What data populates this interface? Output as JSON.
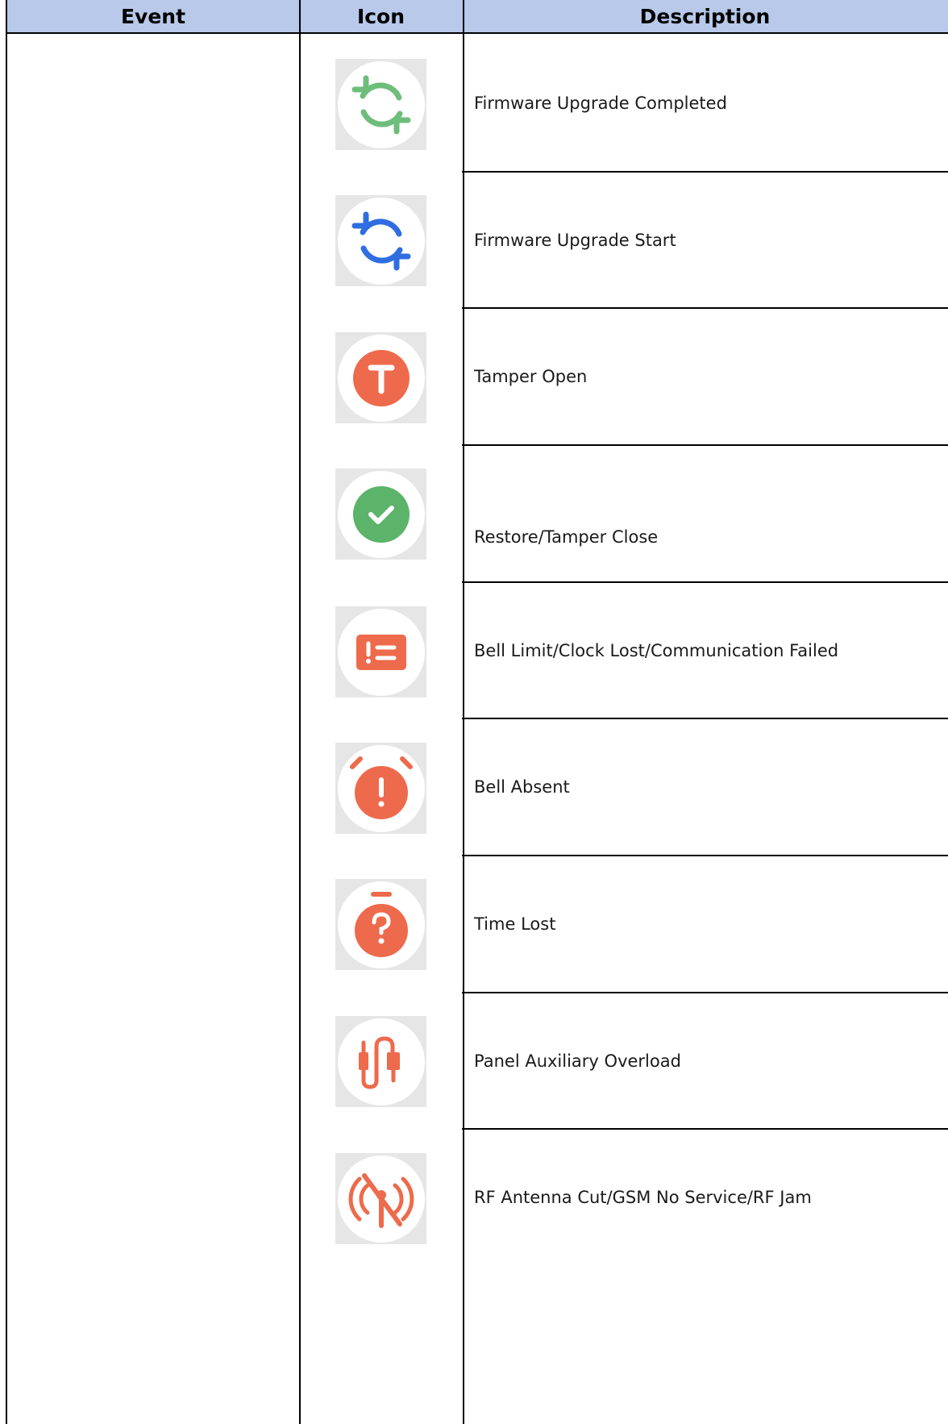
{
  "table": {
    "headers": {
      "event": "Event",
      "icon": "Icon",
      "description": "Description"
    },
    "rows": [
      {
        "icon": "sync-icon",
        "color": "#6dbd7b",
        "description": "Firmware Upgrade Completed"
      },
      {
        "icon": "sync-icon",
        "color": "#2f6de1",
        "description": "Firmware Upgrade Start"
      },
      {
        "icon": "tamper-t-icon",
        "color": "#ee6a4c",
        "description": "Tamper Open"
      },
      {
        "icon": "check-icon",
        "color": "#5cb36a",
        "description": "Restore/Tamper Close"
      },
      {
        "icon": "alert-list-icon",
        "color": "#ee6a4c",
        "description": "Bell Limit/Clock Lost/Communication Failed"
      },
      {
        "icon": "alarm-clock-exclamation-icon",
        "color": "#ee6a4c",
        "description": "Bell Absent"
      },
      {
        "icon": "stopwatch-question-icon",
        "color": "#ee6a4c",
        "description": "Time Lost"
      },
      {
        "icon": "cable-plug-icon",
        "color": "#ee6a4c",
        "description": "Panel Auxiliary Overload"
      },
      {
        "icon": "antenna-off-icon",
        "color": "#ee6a4c",
        "description": "RF Antenna Cut/GSM No Service/RF Jam"
      }
    ]
  }
}
